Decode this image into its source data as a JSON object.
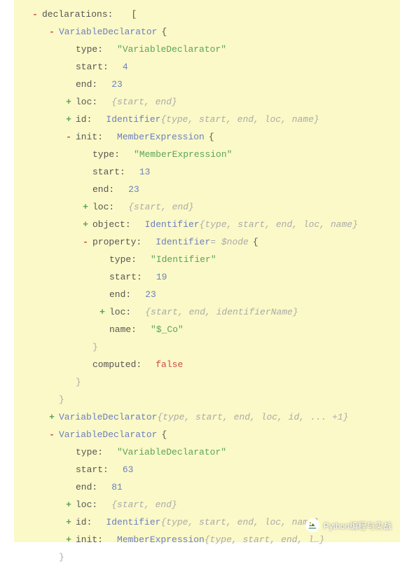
{
  "indentUnit": 24,
  "colors": {
    "background": "#fbf9c7",
    "minus": "#c94c4c",
    "plus": "#5aa45a",
    "nodeName": "#6a7fc1",
    "string": "#5aa45a",
    "number": "#6a7fc1",
    "boolean": "#c94c4c"
  },
  "watermark": {
    "text": "Python编程与实战"
  },
  "rows": [
    {
      "depth": 1,
      "toggle": "-",
      "key": "declarations",
      "suffixBracket": "["
    },
    {
      "depth": 2,
      "toggle": "-",
      "node": "VariableDeclarator",
      "suffixBrace": "{"
    },
    {
      "depth": 3,
      "key": "type",
      "valStr": "\"VariableDeclarator\""
    },
    {
      "depth": 3,
      "key": "start",
      "valNum": "4"
    },
    {
      "depth": 3,
      "key": "end",
      "valNum": "23"
    },
    {
      "depth": 3,
      "toggle": "+",
      "key": "loc",
      "summary": "{start, end}"
    },
    {
      "depth": 3,
      "toggle": "+",
      "key": "id",
      "ident": "Identifier",
      "summary": "{type, start, end, loc, name}"
    },
    {
      "depth": 3,
      "toggle": "-",
      "key": "init",
      "ident": "MemberExpression",
      "suffixBrace": "{"
    },
    {
      "depth": 4,
      "key": "type",
      "valStr": "\"MemberExpression\""
    },
    {
      "depth": 4,
      "key": "start",
      "valNum": "13"
    },
    {
      "depth": 4,
      "key": "end",
      "valNum": "23"
    },
    {
      "depth": 4,
      "toggle": "+",
      "key": "loc",
      "summary": "{start, end}"
    },
    {
      "depth": 4,
      "toggle": "+",
      "key": "object",
      "ident": "Identifier",
      "summary": "{type, start, end, loc, name}"
    },
    {
      "depth": 4,
      "toggle": "-",
      "key": "property",
      "ident": "Identifier",
      "anno": "= $node",
      "suffixBrace": "{"
    },
    {
      "depth": 5,
      "key": "type",
      "valStr": "\"Identifier\""
    },
    {
      "depth": 5,
      "key": "start",
      "valNum": "19"
    },
    {
      "depth": 5,
      "key": "end",
      "valNum": "23"
    },
    {
      "depth": 5,
      "toggle": "+",
      "key": "loc",
      "summary": "{start, end, identifierName}"
    },
    {
      "depth": 5,
      "key": "name",
      "valStr": "\"$_Co\""
    },
    {
      "depth": 4,
      "closeBrace": "}"
    },
    {
      "depth": 4,
      "key": "computed",
      "valBool": "false"
    },
    {
      "depth": 3,
      "closeBrace": "}"
    },
    {
      "depth": 2,
      "closeBrace": "}"
    },
    {
      "depth": 2,
      "toggle": "+",
      "node": "VariableDeclarator",
      "summary": "{type, start, end, loc, id, ... +1}"
    },
    {
      "depth": 2,
      "toggle": "-",
      "node": "VariableDeclarator",
      "suffixBrace": "{"
    },
    {
      "depth": 3,
      "key": "type",
      "valStr": "\"VariableDeclarator\""
    },
    {
      "depth": 3,
      "key": "start",
      "valNum": "63"
    },
    {
      "depth": 3,
      "key": "end",
      "valNum": "81"
    },
    {
      "depth": 3,
      "toggle": "+",
      "key": "loc",
      "summary": "{start, end}"
    },
    {
      "depth": 3,
      "toggle": "+",
      "key": "id",
      "ident": "Identifier",
      "summary": "{type, start, end, loc, name}"
    },
    {
      "depth": 3,
      "toggle": "+",
      "key": "init",
      "ident": "MemberExpression",
      "summary": "{type, start, end, l…}"
    },
    {
      "depth": 2,
      "closeBrace": "}"
    }
  ]
}
